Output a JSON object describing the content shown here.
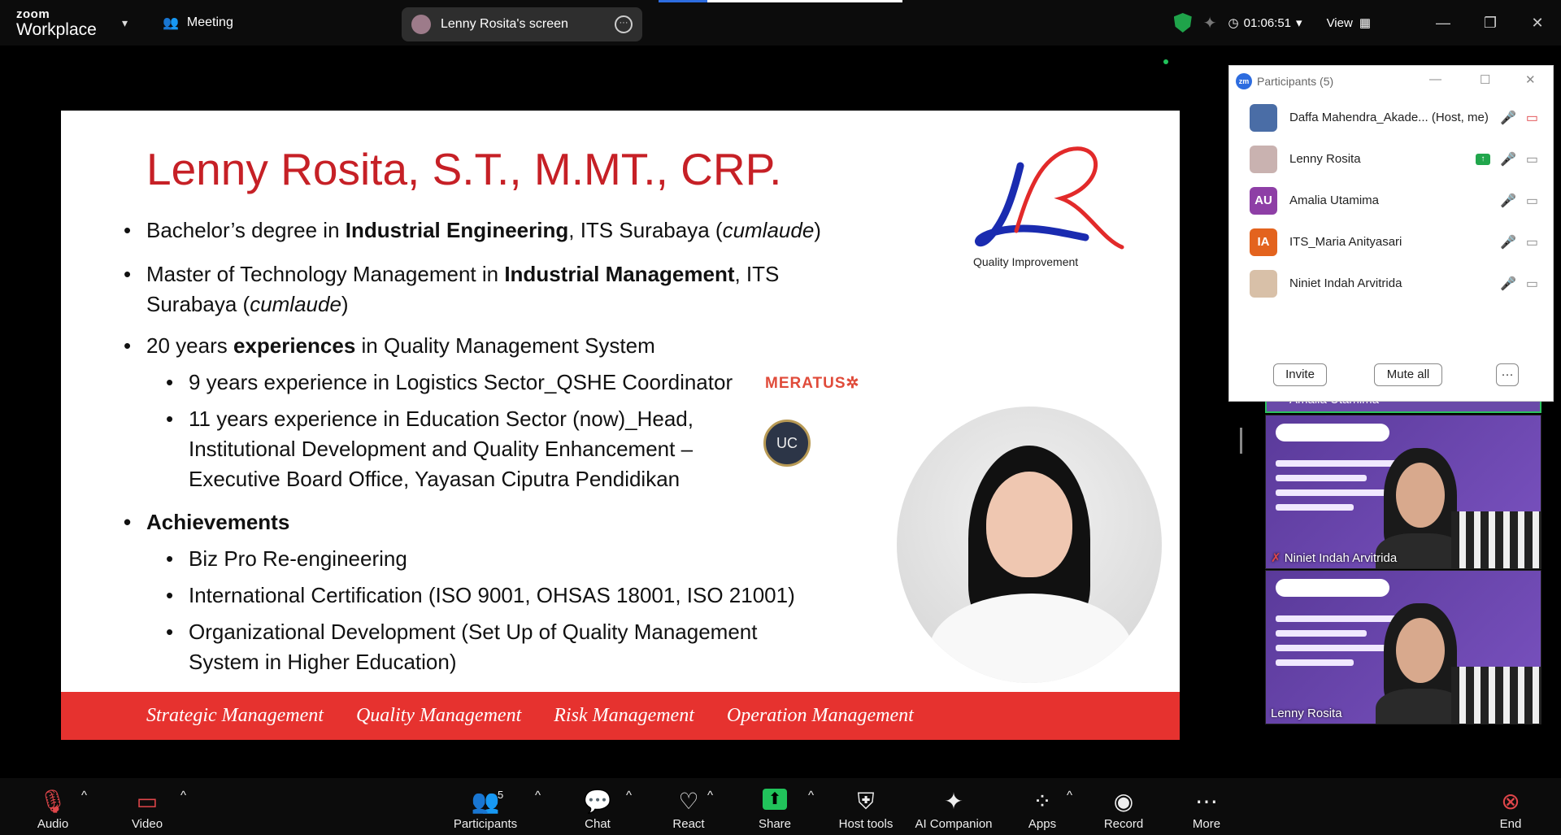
{
  "app": {
    "brand_top": "zoom",
    "brand_bottom": "Workplace",
    "meeting_label": "Meeting"
  },
  "share_pill": {
    "label": "Lenny Rosita's screen"
  },
  "header_right": {
    "timer": "01:06:51",
    "view_label": "View"
  },
  "slide": {
    "title": "Lenny Rosita, S.T., M.MT., CRP.",
    "b1_pre": "Bachelor’s degree in ",
    "b1_bold": "Industrial Engineering",
    "b1_mid": ", ITS Surabaya (",
    "b1_it": "cumlaude",
    "b1_end": ")",
    "b2_pre": "Master of Technology Management in ",
    "b2_bold": "Industrial Management",
    "b2_end": ", ITS",
    "b2_line2_pre": "Surabaya (",
    "b2_line2_it": "cumlaude",
    "b2_line2_end": ")",
    "b3_pre": "20 years ",
    "b3_bold": "experiences",
    "b3_end": " in Quality Management System",
    "sub1": "9 years experience in Logistics Sector_QSHE Coordinator",
    "sub2_l1": "11 years experience in Education Sector (now)_Head,",
    "sub2_l2": "Institutional Development and Quality Enhancement –",
    "sub2_l3": "Executive Board Office, Yayasan Ciputra Pendidikan",
    "ach_title": "Achievements",
    "ach1": "Biz Pro Re-engineering",
    "ach2": "International Certification (ISO 9001, OHSAS 18001, ISO 21001)",
    "ach3_l1": "Organizational Development (Set Up of Quality Management",
    "ach3_l2": "System in Higher Education)",
    "logo_text": "Quality Improvement",
    "meratus": "MERATUS",
    "uc": "UC",
    "band": [
      "Strategic Management",
      "Quality Management",
      "Risk Management",
      "Operation Management"
    ]
  },
  "participants_panel": {
    "title": "Participants (5)",
    "rows": [
      {
        "initials": "",
        "name": "Daffa Mahendra_Akade... (Host, me)"
      },
      {
        "initials": "",
        "name": "Lenny Rosita"
      },
      {
        "initials": "AU",
        "name": "Amalia Utamima",
        "color": "#8e3fa6"
      },
      {
        "initials": "IA",
        "name": "ITS_Maria Anityasari",
        "color": "#e3631e"
      },
      {
        "initials": "",
        "name": "Niniet Indah Arvitrida"
      }
    ],
    "invite": "Invite",
    "mute_all": "Mute all",
    "more": "···"
  },
  "video_tiles": {
    "tile0_name": "Amalia Utamima",
    "tile1_name": "Niniet Indah Arvitrida",
    "tile2_name": "Lenny Rosita"
  },
  "toolbar": {
    "audio": "Audio",
    "video": "Video",
    "participants": "Participants",
    "participants_count": "5",
    "chat": "Chat",
    "react": "React",
    "share": "Share",
    "host_tools": "Host tools",
    "ai": "AI Companion",
    "apps": "Apps",
    "record": "Record",
    "more": "More",
    "end": "End"
  }
}
